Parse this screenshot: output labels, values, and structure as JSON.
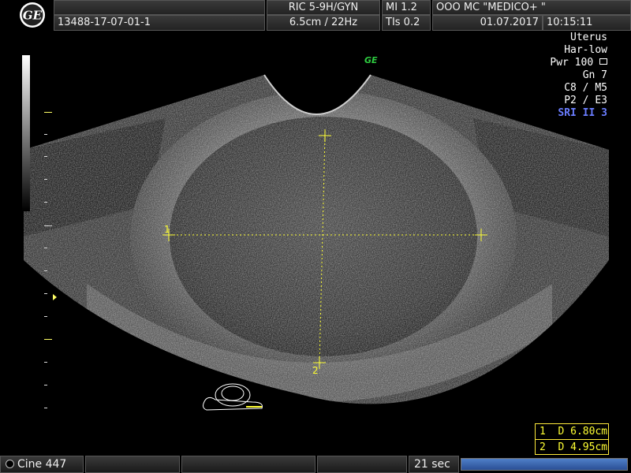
{
  "header": {
    "probe": "RIC 5-9H/GYN",
    "mi": "MI  1.2",
    "institution": "OOO  MC \"MEDICO+ \"",
    "patient_id": "13488-17-07-01-1",
    "depth_freq": "6.5cm / 22Hz",
    "tis": "TIs  0.2",
    "date": "01.07.2017",
    "time": "10:15:11"
  },
  "logo_text": "GE",
  "params": {
    "preset": "Uterus",
    "harmonic": "Har-low",
    "power": "Pwr 100",
    "gain": "Gn   7",
    "c_m": "C8 / M5",
    "p_e": "P2 / E3",
    "sri": "SRI II 3"
  },
  "image_marker": "GE",
  "calipers": {
    "label1": "1",
    "label2": "2"
  },
  "measurements": [
    {
      "index": "1",
      "label": "D 6.80cm"
    },
    {
      "index": "2",
      "label": "D 4.95cm"
    }
  ],
  "footer": {
    "cine": "Cine 447",
    "timer": "21 sec"
  },
  "colors": {
    "caliper": "#ffff33",
    "sri": "#6a7dff",
    "progress": "#3d6bb8"
  }
}
